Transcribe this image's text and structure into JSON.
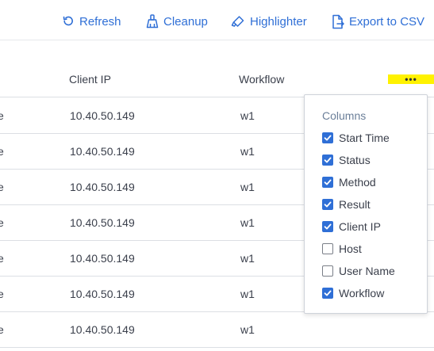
{
  "toolbar": {
    "refresh_label": "Refresh",
    "cleanup_label": "Cleanup",
    "highlighter_label": "Highlighter",
    "export_label": "Export to CSV"
  },
  "table": {
    "headers": {
      "client_ip": "Client IP",
      "workflow": "Workflow"
    },
    "more_label": "•••",
    "rows": [
      {
        "partial": "e",
        "client_ip": "10.40.50.149",
        "workflow": "w1"
      },
      {
        "partial": "e",
        "client_ip": "10.40.50.149",
        "workflow": "w1"
      },
      {
        "partial": "e",
        "client_ip": "10.40.50.149",
        "workflow": "w1"
      },
      {
        "partial": "e",
        "client_ip": "10.40.50.149",
        "workflow": "w1"
      },
      {
        "partial": "e",
        "client_ip": "10.40.50.149",
        "workflow": "w1"
      },
      {
        "partial": "e",
        "client_ip": "10.40.50.149",
        "workflow": "w1"
      },
      {
        "partial": "e",
        "client_ip": "10.40.50.149",
        "workflow": "w1"
      }
    ]
  },
  "columns_panel": {
    "title": "Columns",
    "options": [
      {
        "label": "Start Time",
        "checked": true
      },
      {
        "label": "Status",
        "checked": true
      },
      {
        "label": "Method",
        "checked": true
      },
      {
        "label": "Result",
        "checked": true
      },
      {
        "label": "Client IP",
        "checked": true
      },
      {
        "label": "Host",
        "checked": false
      },
      {
        "label": "User Name",
        "checked": false
      },
      {
        "label": "Workflow",
        "checked": true
      }
    ]
  },
  "colors": {
    "accent": "#2f6fd6",
    "highlight": "#fff200"
  }
}
